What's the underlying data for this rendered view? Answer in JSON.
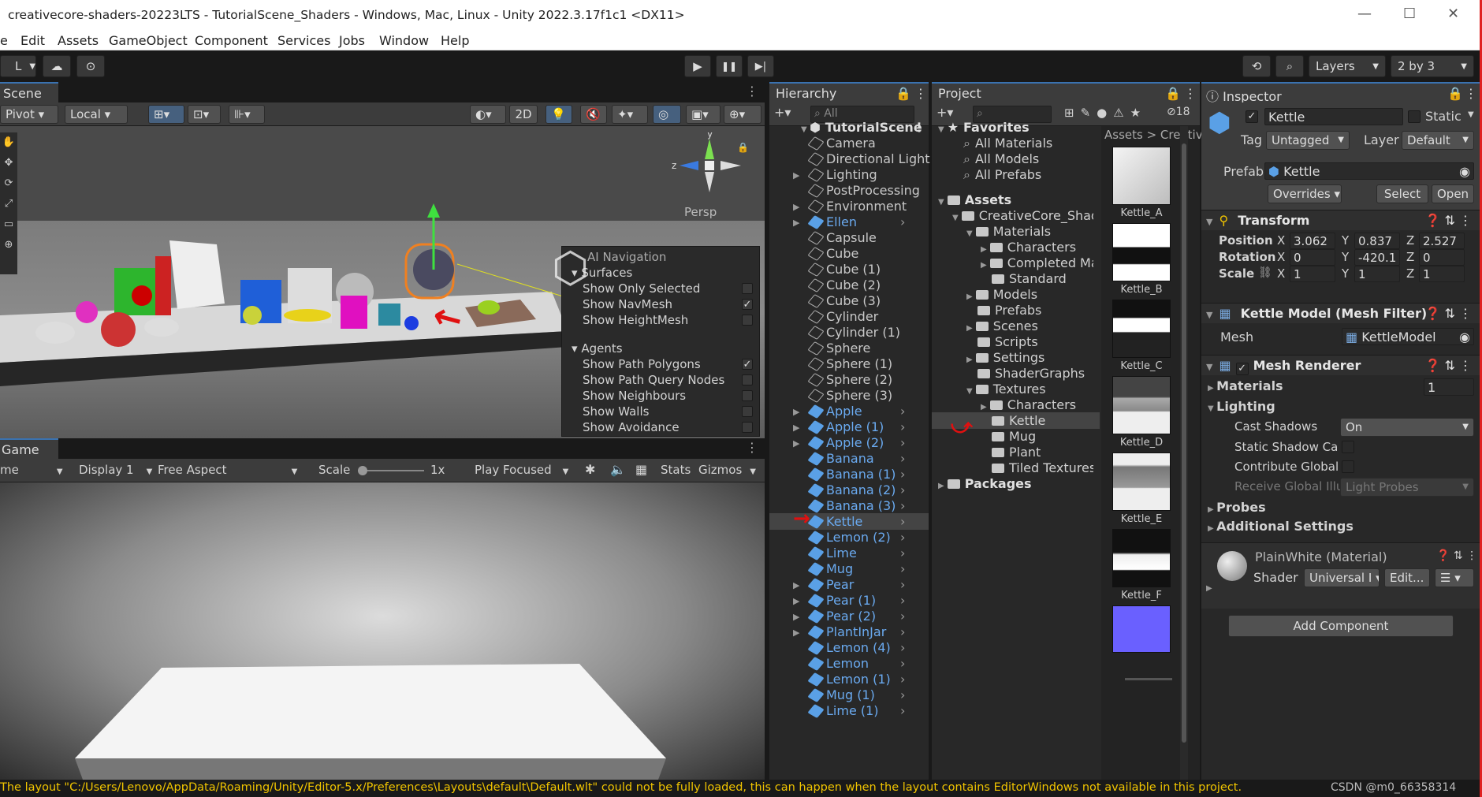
{
  "window": {
    "title": "creativecore-shaders-20223LTS - TutorialScene_Shaders - Windows, Mac, Linux - Unity 2022.3.17f1c1 <DX11>",
    "minimize": "—",
    "maximize": "☐",
    "close": "✕"
  },
  "menu": [
    "e",
    "Edit",
    "Assets",
    "GameObject",
    "Component",
    "Services",
    "Jobs",
    "Window",
    "Help"
  ],
  "toolbar": {
    "account": "L",
    "layers": "Layers",
    "layout": "2 by 3",
    "play": "▶",
    "pause": "❚❚",
    "step": "▶|"
  },
  "scene": {
    "tab": "Scene",
    "pivot": "Pivot",
    "local": "Local",
    "twod": "2D",
    "persp": "Persp",
    "ai_nav": {
      "title": "AI Navigation",
      "surfaces": "Surfaces",
      "surface_items": [
        {
          "label": "Show Only Selected",
          "checked": false
        },
        {
          "label": "Show NavMesh",
          "checked": true
        },
        {
          "label": "Show HeightMesh",
          "checked": false
        }
      ],
      "agents": "Agents",
      "agent_items": [
        {
          "label": "Show Path Polygons",
          "checked": true
        },
        {
          "label": "Show Path Query Nodes",
          "checked": false
        },
        {
          "label": "Show Neighbours",
          "checked": false
        },
        {
          "label": "Show Walls",
          "checked": false
        },
        {
          "label": "Show Avoidance",
          "checked": false
        }
      ]
    }
  },
  "game": {
    "tab": "Game",
    "view": "me",
    "display": "Display 1",
    "aspect": "Free Aspect",
    "scale_label": "Scale",
    "scale_value": "1x",
    "play_focused": "Play Focused",
    "stats": "Stats",
    "gizmos": "Gizmos"
  },
  "hierarchy": {
    "tab": "Hierarchy",
    "search": "All",
    "scene": "TutorialScene",
    "items": [
      {
        "name": "Camera",
        "prefab": false,
        "expand": false,
        "more": false
      },
      {
        "name": "Directional Light",
        "prefab": false,
        "expand": false,
        "more": false
      },
      {
        "name": "Lighting",
        "prefab": false,
        "expand": true,
        "more": false
      },
      {
        "name": "PostProcessing",
        "prefab": false,
        "expand": false,
        "more": false
      },
      {
        "name": "Environment",
        "prefab": false,
        "expand": true,
        "more": false
      },
      {
        "name": "Ellen",
        "prefab": true,
        "expand": true,
        "more": true
      },
      {
        "name": "Capsule",
        "prefab": false,
        "expand": false,
        "more": false
      },
      {
        "name": "Cube",
        "prefab": false,
        "expand": false,
        "more": false
      },
      {
        "name": "Cube (1)",
        "prefab": false,
        "expand": false,
        "more": false
      },
      {
        "name": "Cube (2)",
        "prefab": false,
        "expand": false,
        "more": false
      },
      {
        "name": "Cube (3)",
        "prefab": false,
        "expand": false,
        "more": false
      },
      {
        "name": "Cylinder",
        "prefab": false,
        "expand": false,
        "more": false
      },
      {
        "name": "Cylinder (1)",
        "prefab": false,
        "expand": false,
        "more": false
      },
      {
        "name": "Sphere",
        "prefab": false,
        "expand": false,
        "more": false
      },
      {
        "name": "Sphere (1)",
        "prefab": false,
        "expand": false,
        "more": false
      },
      {
        "name": "Sphere (2)",
        "prefab": false,
        "expand": false,
        "more": false
      },
      {
        "name": "Sphere (3)",
        "prefab": false,
        "expand": false,
        "more": false
      },
      {
        "name": "Apple",
        "prefab": true,
        "expand": true,
        "more": true
      },
      {
        "name": "Apple (1)",
        "prefab": true,
        "expand": true,
        "more": true
      },
      {
        "name": "Apple (2)",
        "prefab": true,
        "expand": true,
        "more": true
      },
      {
        "name": "Banana",
        "prefab": true,
        "expand": false,
        "more": true
      },
      {
        "name": "Banana (1)",
        "prefab": true,
        "expand": false,
        "more": true
      },
      {
        "name": "Banana (2)",
        "prefab": true,
        "expand": false,
        "more": true
      },
      {
        "name": "Banana (3)",
        "prefab": true,
        "expand": false,
        "more": true
      },
      {
        "name": "Kettle",
        "prefab": true,
        "expand": false,
        "more": true,
        "selected": true
      },
      {
        "name": "Lemon (2)",
        "prefab": true,
        "expand": false,
        "more": true
      },
      {
        "name": "Lime",
        "prefab": true,
        "expand": false,
        "more": true
      },
      {
        "name": "Mug",
        "prefab": true,
        "expand": false,
        "more": true
      },
      {
        "name": "Pear",
        "prefab": true,
        "expand": true,
        "more": true
      },
      {
        "name": "Pear (1)",
        "prefab": true,
        "expand": true,
        "more": true
      },
      {
        "name": "Pear (2)",
        "prefab": true,
        "expand": true,
        "more": true
      },
      {
        "name": "PlantInJar",
        "prefab": true,
        "expand": true,
        "more": true
      },
      {
        "name": "Lemon (4)",
        "prefab": true,
        "expand": false,
        "more": true
      },
      {
        "name": "Lemon",
        "prefab": true,
        "expand": false,
        "more": true
      },
      {
        "name": "Lemon (1)",
        "prefab": true,
        "expand": false,
        "more": true
      },
      {
        "name": "Mug (1)",
        "prefab": true,
        "expand": false,
        "more": true
      },
      {
        "name": "Lime (1)",
        "prefab": true,
        "expand": false,
        "more": true
      }
    ]
  },
  "project": {
    "tab": "Project",
    "count": "18",
    "breadcrumb": "Assets > Creativ",
    "tree": [
      {
        "label": "Favorites",
        "indent": 0,
        "bold": true,
        "type": "star",
        "expand": "open"
      },
      {
        "label": "All Materials",
        "indent": 1,
        "type": "search"
      },
      {
        "label": "All Models",
        "indent": 1,
        "type": "search"
      },
      {
        "label": "All Prefabs",
        "indent": 1,
        "type": "search"
      },
      {
        "label": "",
        "indent": 0,
        "type": "gap"
      },
      {
        "label": "Assets",
        "indent": 0,
        "bold": true,
        "type": "folder",
        "expand": "open"
      },
      {
        "label": "CreativeCore_Shaders",
        "indent": 1,
        "type": "folder",
        "expand": "open"
      },
      {
        "label": "Materials",
        "indent": 2,
        "type": "folder",
        "expand": "open"
      },
      {
        "label": "Characters",
        "indent": 3,
        "type": "folder",
        "expand": "closed"
      },
      {
        "label": "Completed Materials",
        "indent": 3,
        "type": "folder",
        "expand": "closed"
      },
      {
        "label": "Standard",
        "indent": 3,
        "type": "folder"
      },
      {
        "label": "Models",
        "indent": 2,
        "type": "folder",
        "expand": "closed"
      },
      {
        "label": "Prefabs",
        "indent": 2,
        "type": "folder"
      },
      {
        "label": "Scenes",
        "indent": 2,
        "type": "folder",
        "expand": "closed"
      },
      {
        "label": "Scripts",
        "indent": 2,
        "type": "folder"
      },
      {
        "label": "Settings",
        "indent": 2,
        "type": "folder",
        "expand": "closed"
      },
      {
        "label": "ShaderGraphs",
        "indent": 2,
        "type": "folder"
      },
      {
        "label": "Textures",
        "indent": 2,
        "type": "folder",
        "expand": "open"
      },
      {
        "label": "Characters",
        "indent": 3,
        "type": "folder",
        "expand": "closed"
      },
      {
        "label": "Kettle",
        "indent": 3,
        "type": "folder",
        "selected": true
      },
      {
        "label": "Mug",
        "indent": 3,
        "type": "folder"
      },
      {
        "label": "Plant",
        "indent": 3,
        "type": "folder"
      },
      {
        "label": "Tiled Textures",
        "indent": 3,
        "type": "folder"
      },
      {
        "label": "Packages",
        "indent": 0,
        "bold": true,
        "type": "folder",
        "expand": "closed"
      }
    ],
    "thumbs": [
      "Kettle_A",
      "Kettle_B",
      "Kettle_C",
      "Kettle_D",
      "Kettle_E",
      "Kettle_F"
    ]
  },
  "inspector": {
    "tab": "Inspector",
    "name": "Kettle",
    "static": "Static",
    "tag_label": "Tag",
    "tag": "Untagged",
    "layer_label": "Layer",
    "layer": "Default",
    "prefab_label": "Prefab",
    "prefab": "Kettle",
    "overrides": "Overrides",
    "select": "Select",
    "open": "Open",
    "transform": {
      "title": "Transform",
      "position": {
        "label": "Position",
        "x": "3.062",
        "y": "0.837",
        "z": "2.527"
      },
      "rotation": {
        "label": "Rotation",
        "x": "0",
        "y": "-420.1",
        "z": "0"
      },
      "scale": {
        "label": "Scale",
        "x": "1",
        "y": "1",
        "z": "1"
      }
    },
    "mesh_filter": {
      "title": "Kettle Model (Mesh Filter)",
      "mesh_label": "Mesh",
      "mesh": "KettleModel"
    },
    "mesh_renderer": {
      "title": "Mesh Renderer",
      "materials": "Materials",
      "materials_count": "1",
      "lighting": "Lighting",
      "cast_shadows_label": "Cast Shadows",
      "cast_shadows": "On",
      "static_shadow": "Static Shadow Ca",
      "contribute_gi": "Contribute Global",
      "receive_gi": "Receive Global Illu",
      "receive_gi_value": "Light Probes",
      "probes": "Probes",
      "additional": "Additional Settings"
    },
    "material": {
      "name": "PlainWhite (Material)",
      "shader_label": "Shader",
      "shader": "Universal I",
      "edit": "Edit..."
    },
    "add_component": "Add Component"
  },
  "console": {
    "message": "The layout \"C:/Users/Lenovo/AppData/Roaming/Unity/Editor-5.x/Preferences\\Layouts\\default\\Default.wlt\" could not be fully loaded, this can happen when the layout contains EditorWindows not available in this project.",
    "watermark": "CSDN @m0_66358314"
  },
  "colors": {
    "accent": "#3a72b0",
    "prefab": "#5aa0e6",
    "warning": "#f0c400",
    "annotation": "#e01010"
  }
}
